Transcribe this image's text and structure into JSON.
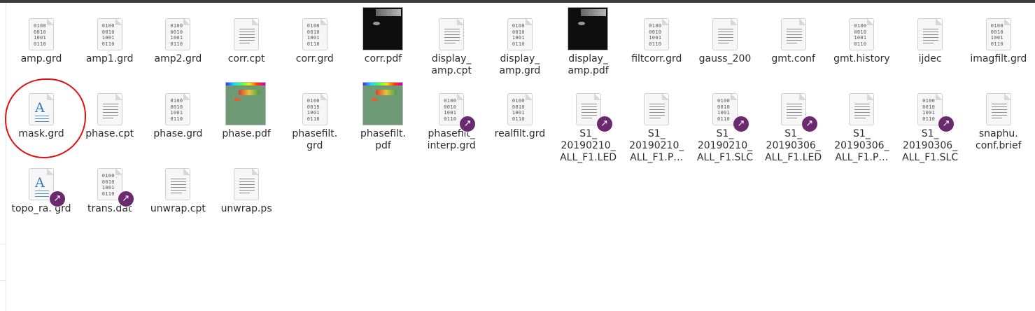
{
  "files": [
    {
      "name": "amp.grd",
      "icon": "binary-file-icon"
    },
    {
      "name": "amp1.grd",
      "icon": "binary-file-icon"
    },
    {
      "name": "amp2.grd",
      "icon": "binary-file-icon"
    },
    {
      "name": "corr.cpt",
      "icon": "text-file-icon"
    },
    {
      "name": "corr.grd",
      "icon": "binary-file-icon"
    },
    {
      "name": "corr.pdf",
      "icon": "pdf-thumbnail-dark"
    },
    {
      "name": "display_ amp.cpt",
      "icon": "text-file-icon"
    },
    {
      "name": "display_ amp.grd",
      "icon": "binary-file-icon"
    },
    {
      "name": "display_ amp.pdf",
      "icon": "pdf-thumbnail-dark"
    },
    {
      "name": "filtcorr.grd",
      "icon": "binary-file-icon"
    },
    {
      "name": "gauss_200",
      "icon": "text-file-icon"
    },
    {
      "name": "gmt.conf",
      "icon": "text-file-icon"
    },
    {
      "name": "gmt.history",
      "icon": "binary-file-icon"
    },
    {
      "name": "ijdec",
      "icon": "text-file-icon"
    },
    {
      "name": "imagfilt.grd",
      "icon": "binary-file-icon"
    },
    {
      "name": "mask.grd",
      "icon": "rich-text-file-icon"
    },
    {
      "name": "phase.cpt",
      "icon": "text-file-icon"
    },
    {
      "name": "phase.grd",
      "icon": "binary-file-icon"
    },
    {
      "name": "phase.pdf",
      "icon": "pdf-thumbnail-green"
    },
    {
      "name": "phasefilt. grd",
      "icon": "binary-file-icon"
    },
    {
      "name": "phasefilt. pdf",
      "icon": "pdf-thumbnail-green"
    },
    {
      "name": "phasefilt_ interp.grd",
      "icon": "binary-file-icon",
      "link": true
    },
    {
      "name": "realfilt.grd",
      "icon": "binary-file-icon"
    },
    {
      "name": "S1_ 20190210_ ALL_F1.LED",
      "icon": "text-file-icon",
      "link": true
    },
    {
      "name": "S1_ 20190210_ ALL_F1.P…",
      "icon": "text-file-icon"
    },
    {
      "name": "S1_ 20190210_ ALL_F1.SLC",
      "icon": "binary-file-icon",
      "link": true
    },
    {
      "name": "S1_ 20190306_ ALL_F1.LED",
      "icon": "text-file-icon",
      "link": true
    },
    {
      "name": "S1_ 20190306_ ALL_F1.P…",
      "icon": "text-file-icon"
    },
    {
      "name": "S1_ 20190306_ ALL_F1.SLC",
      "icon": "binary-file-icon",
      "link": true
    },
    {
      "name": "snaphu. conf.brief",
      "icon": "text-file-icon"
    },
    {
      "name": "topo_ra. grd",
      "icon": "rich-text-file-icon",
      "link": true
    },
    {
      "name": "trans.dat",
      "icon": "binary-file-icon",
      "link": true
    },
    {
      "name": "unwrap.cpt",
      "icon": "text-file-icon"
    },
    {
      "name": "unwrap.ps",
      "icon": "text-file-icon"
    }
  ],
  "binary_glyph": "0100\n0010\n1001\n0110",
  "rich_text_glyph": "A",
  "link_glyph": "↗",
  "colors": {
    "annotation": "#e01010",
    "link_badge": "#6b2a6f",
    "rich_text": "#3a78b9"
  }
}
